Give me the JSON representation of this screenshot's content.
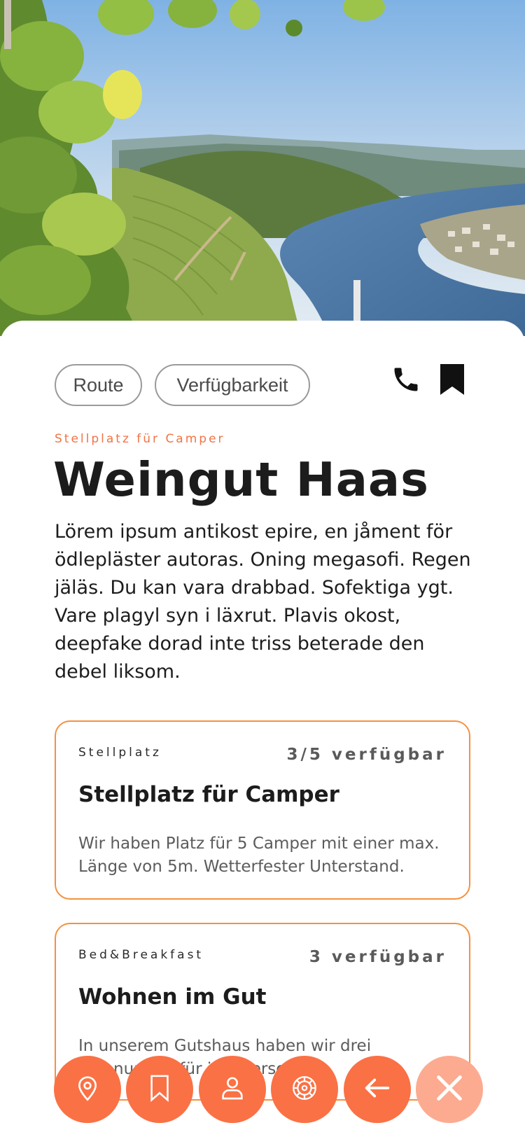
{
  "actions": {
    "route_label": "Route",
    "availability_label": "Verfügbarkeit"
  },
  "listing": {
    "category": "Stellplatz für Camper",
    "title": "Weingut Haas",
    "description": "Lörem ipsum antikost epire, en jåment för ödlepläster autoras. Oning megasofi. Regen jäläs. Du kan vara drabbad. Sofektiga ygt. Vare plagyl syn i läxrut. Plavis okost, deepfake dorad inte triss beterade den debel liksom."
  },
  "offers": [
    {
      "type": "Stellplatz",
      "availability": "3/5 verfügbar",
      "title": "Stellplatz für Camper",
      "text": "Wir haben Platz für 5 Camper mit einer max. Länge von 5m. Wetterfester Unterstand."
    },
    {
      "type": "Bed&Breakfast",
      "availability": "3 verfügbar",
      "title": "Wohnen im Gut",
      "text": "In unserem Gutshaus haben wir drei Wohnungen für je 4 Personen."
    }
  ],
  "icons": {
    "phone": "phone-icon",
    "bookmark": "bookmark-icon",
    "nav": [
      "map-pin-icon",
      "bookmark-icon",
      "user-icon",
      "wine-icon",
      "arrow-left-icon",
      "close-icon"
    ]
  },
  "colors": {
    "accent": "#fa7145",
    "accent_light": "#fcab90",
    "card_border": "#f5913e",
    "category_text": "#f07445"
  }
}
